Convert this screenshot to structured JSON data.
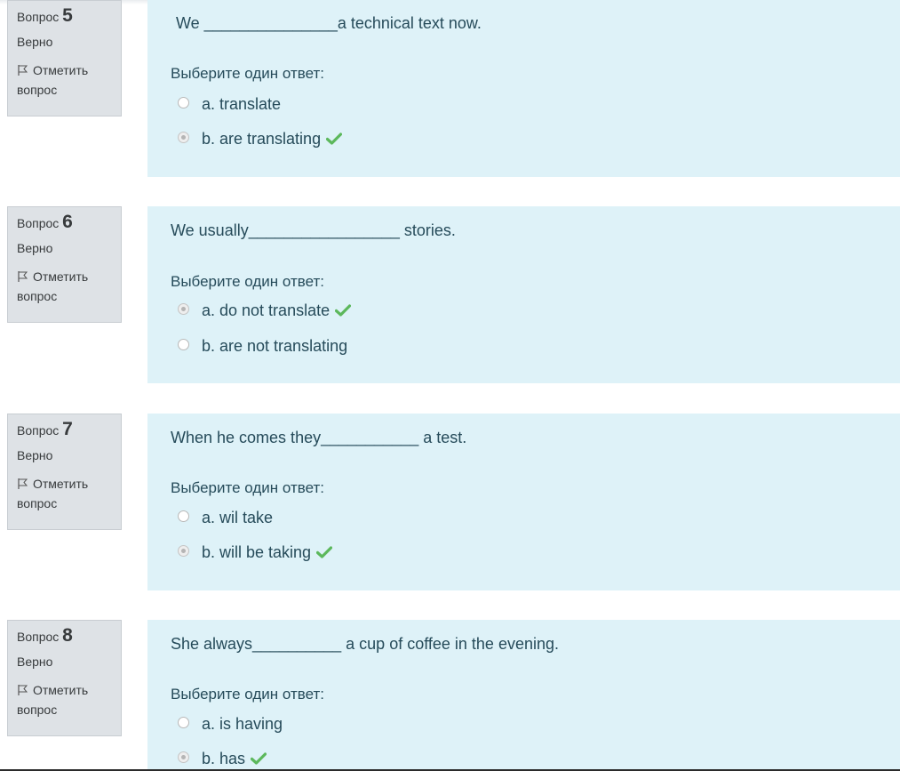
{
  "prompt": "Выберите один ответ:",
  "questions": [
    {
      "label": "Вопрос",
      "number": "5",
      "state": "Верно",
      "flag_label": "Отметить вопрос",
      "text": "We _______________a technical text now.",
      "answers": [
        {
          "text": "a. translate",
          "checked": false,
          "correct": false
        },
        {
          "text": "b. are translating",
          "checked": true,
          "correct": true
        }
      ]
    },
    {
      "label": "Вопрос",
      "number": "6",
      "state": "Верно",
      "flag_label": "Отметить вопрос",
      "text": "We usually_________________ stories.",
      "answers": [
        {
          "text": "a. do not translate",
          "checked": true,
          "correct": true
        },
        {
          "text": "b. are not translating",
          "checked": false,
          "correct": false
        }
      ]
    },
    {
      "label": "Вопрос",
      "number": "7",
      "state": "Верно",
      "flag_label": "Отметить вопрос",
      "text": "When he comes they___________ a test.",
      "answers": [
        {
          "text": "a. wil take",
          "checked": false,
          "correct": false
        },
        {
          "text": "b. will be taking",
          "checked": true,
          "correct": true
        }
      ]
    },
    {
      "label": "Вопрос",
      "number": "8",
      "state": "Верно",
      "flag_label": "Отметить вопрос",
      "text": "She always__________ a cup of coffee in the evening.",
      "answers": [
        {
          "text": "a. is having",
          "checked": false,
          "correct": false
        },
        {
          "text": "b. has",
          "checked": true,
          "correct": true
        }
      ]
    }
  ],
  "colors": {
    "content_bg": "#def2f8",
    "info_bg": "#dee2e6",
    "text": "#264b5a",
    "check": "#5cb85c"
  },
  "icons": {
    "flag": "flag-icon",
    "correct": "check-icon"
  }
}
